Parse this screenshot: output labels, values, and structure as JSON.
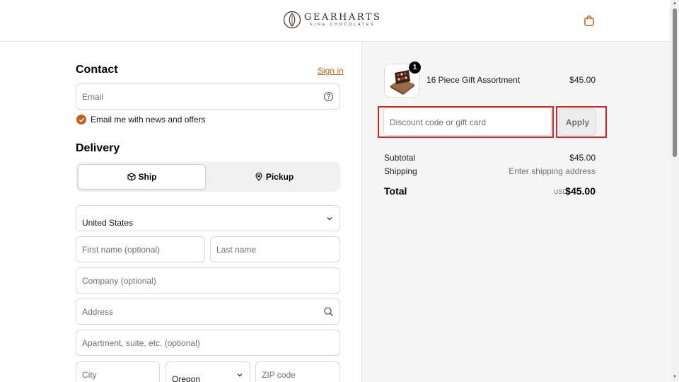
{
  "header": {
    "brand_name": "GEARHARTS",
    "brand_tagline": "FINE CHOCOLATES",
    "cart_icon": "shopping-bag-icon"
  },
  "contact": {
    "title": "Contact",
    "signin_label": "Sign in",
    "email_placeholder": "Email",
    "newsletter_label": "Email me with news and offers",
    "newsletter_checked": true
  },
  "delivery": {
    "title": "Delivery",
    "ship_label": "Ship",
    "pickup_label": "Pickup",
    "selected": "Ship",
    "country": "United States",
    "first_name_placeholder": "First name (optional)",
    "last_name_placeholder": "Last name",
    "company_placeholder": "Company (optional)",
    "address_placeholder": "Address",
    "apartment_placeholder": "Apartment, suite, etc. (optional)",
    "city_placeholder": "City",
    "state": "Oregon",
    "zip_placeholder": "ZIP code"
  },
  "summary": {
    "item": {
      "name": "16 Piece Gift Assortment",
      "price": "$45.00",
      "quantity": "1"
    },
    "discount_placeholder": "Discount code or gift card",
    "apply_label": "Apply",
    "subtotal_label": "Subtotal",
    "subtotal_value": "$45.00",
    "shipping_label": "Shipping",
    "shipping_value": "Enter shipping address",
    "total_label": "Total",
    "total_currency": "USD",
    "total_value": "$45.00"
  },
  "colors": {
    "accent": "#c2611f",
    "highlight": "#d4232a",
    "summary_bg": "#f5f5f5"
  }
}
